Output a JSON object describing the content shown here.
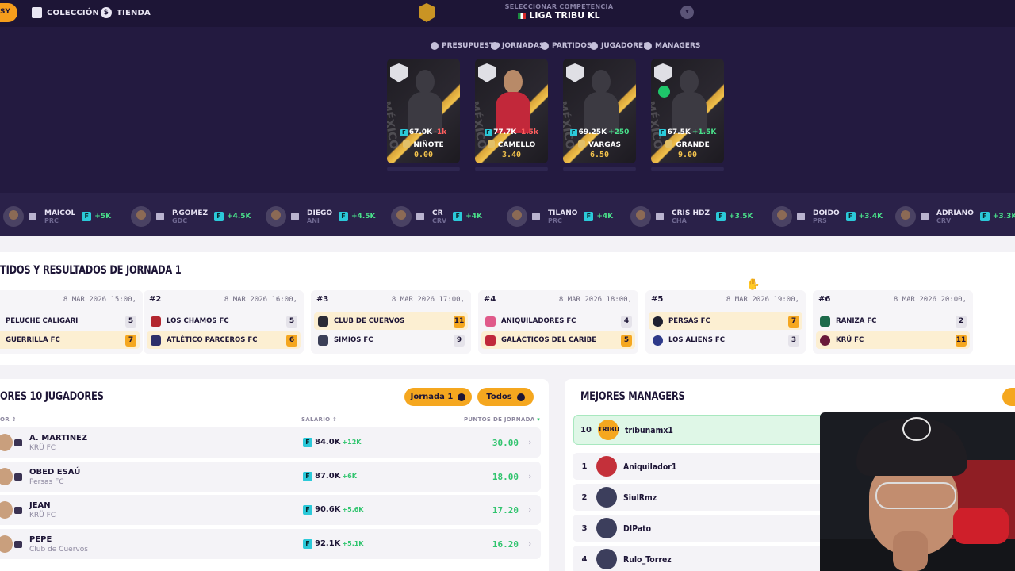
{
  "topnav": {
    "left_pill": "SY",
    "items": [
      {
        "label": "COLECCIÓN",
        "icon": "collection-icon"
      },
      {
        "label": "TIENDA",
        "icon": "coin-icon"
      }
    ],
    "competition_label": "SELECCIONAR COMPETENCIA",
    "competition_name": "LIGA TRIBU KL"
  },
  "subnav": [
    "PRESUPUESTO",
    "JORNADAS",
    "PARTIDOS",
    "JUGADORES",
    "MANAGERS"
  ],
  "cards": [
    {
      "price": "67.0K",
      "delta": "-1k",
      "name": "NIÑOTE",
      "score": "0.00"
    },
    {
      "price": "77.7K",
      "delta": "-1.5k",
      "name": "CAMELLO",
      "score": "3.40"
    },
    {
      "price": "69.25K",
      "delta": "+250",
      "name": "VARGAS",
      "score": "6.50"
    },
    {
      "price": "67.5K",
      "delta": "+1.5K",
      "name": "GRANDE",
      "score": "9.00"
    }
  ],
  "ticker": [
    {
      "name": "MAICOL",
      "club": "PRC",
      "amount": "+5K"
    },
    {
      "name": "P.GOMEZ",
      "club": "GDC",
      "amount": "+4.5K"
    },
    {
      "name": "DIEGO",
      "club": "ANI",
      "amount": "+4.5K"
    },
    {
      "name": "CR",
      "club": "CRV",
      "amount": "+4K"
    },
    {
      "name": "TILANO",
      "club": "PRC",
      "amount": "+4K"
    },
    {
      "name": "CRIS HDZ",
      "club": "CHA",
      "amount": "+3.5K"
    },
    {
      "name": "DOIDO",
      "club": "PRS",
      "amount": "+3.4K"
    },
    {
      "name": "ADRIANO",
      "club": "CRV",
      "amount": "+3.3K"
    }
  ],
  "results": {
    "title": "TIDOS Y RESULTADOS DE JORNADA 1",
    "matches": [
      {
        "num": "",
        "date": "8 MAR 2026 15:00,",
        "home": "PELUCHE CALIGARI",
        "home_score": "5",
        "away": "GUERRILLA FC",
        "away_score": "7"
      },
      {
        "num": "#2",
        "date": "8 MAR 2026 16:00,",
        "home": "LOS CHAMOS FC",
        "home_score": "5",
        "away": "ATLÉTICO PARCEROS FC",
        "away_score": "6"
      },
      {
        "num": "#3",
        "date": "8 MAR 2026 17:00,",
        "home": "CLUB DE CUERVOS",
        "home_score": "11",
        "away": "SIMIOS FC",
        "away_score": "9"
      },
      {
        "num": "#4",
        "date": "8 MAR 2026 18:00,",
        "home": "ANIQUILADORES FC",
        "home_score": "4",
        "away": "GALÁCTICOS DEL CARIBE",
        "away_score": "5"
      },
      {
        "num": "#5",
        "date": "8 MAR 2026 19:00,",
        "home": "PERSAS FC",
        "home_score": "7",
        "away": "LOS ALIENS FC",
        "away_score": "3"
      },
      {
        "num": "#6",
        "date": "8 MAR 2026 20:00,",
        "home": "RANIZA FC",
        "home_score": "2",
        "away": "KRÜ FC",
        "away_score": "11"
      }
    ]
  },
  "players": {
    "title": "ORES 10 JUGADORES",
    "pill_jornada": "Jornada 1",
    "pill_todos": "Todos",
    "col_player": "OR",
    "col_salary": "SALARIO",
    "col_points": "PUNTOS DE JORNADA",
    "rows": [
      {
        "name": "A. MARTINEZ",
        "club": "KRÜ FC",
        "salary": "84.0K",
        "change": "+12K",
        "points": "30.00"
      },
      {
        "name": "OBED ESAÚ",
        "club": "Persas FC",
        "salary": "87.0K",
        "change": "+6K",
        "points": "18.00"
      },
      {
        "name": "JEAN",
        "club": "KRÜ FC",
        "salary": "90.6K",
        "change": "+5.6K",
        "points": "17.20"
      },
      {
        "name": "PEPE",
        "club": "Club de Cuervos",
        "salary": "92.1K",
        "change": "+5.1K",
        "points": "16.20"
      }
    ]
  },
  "managers": {
    "title": "MEJORES MANAGERS",
    "me": {
      "rank": "10",
      "avatar": "TRIBU",
      "name": "tribunamx1"
    },
    "rows": [
      {
        "rank": "1",
        "name": "Aniquilador1"
      },
      {
        "rank": "2",
        "name": "SiulRmz"
      },
      {
        "rank": "3",
        "name": "DIPato"
      },
      {
        "rank": "4",
        "name": "Rulo_Torrez"
      }
    ]
  },
  "colors": {
    "accent": "#f5a71f",
    "dark": "#231a40",
    "positive": "#30c46e"
  }
}
